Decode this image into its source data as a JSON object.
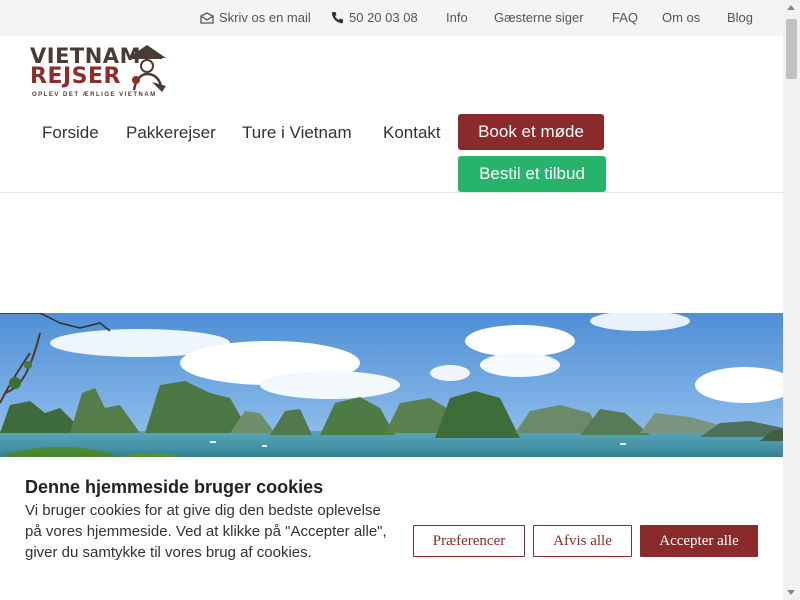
{
  "topbar": {
    "mail": "Skriv os en mail",
    "phone": "50 20 03 08",
    "links": [
      "Info",
      "Gæsterne siger",
      "FAQ",
      "Om os",
      "Blog"
    ]
  },
  "logo": {
    "line1": "VIETNAM",
    "line2": "REJSER",
    "tagline": "OPLEV DET ÆRLIGE VIETNAM"
  },
  "nav": {
    "items": [
      "Forside",
      "Pakkerejser",
      "Ture i Vietnam",
      "Kontakt"
    ],
    "book_meeting": "Book et møde",
    "order_offer": "Bestil et tilbud"
  },
  "hero": {
    "icon": "ha-long-bay-photo"
  },
  "cookie": {
    "title": "Denne hjemmeside bruger cookies",
    "text": "Vi bruger cookies for at give dig den bedste oplevelse på vores hjemmeside. Ved at klikke på \"Accepter alle\", giver du samtykke til vores brug af cookies.",
    "preferences": "Præferencer",
    "reject_all": "Afvis alle",
    "accept_all": "Accepter alle"
  },
  "colors": {
    "brand": "#8b2a2a",
    "green": "#27b36a",
    "topbar_bg": "#f4f4f4"
  }
}
